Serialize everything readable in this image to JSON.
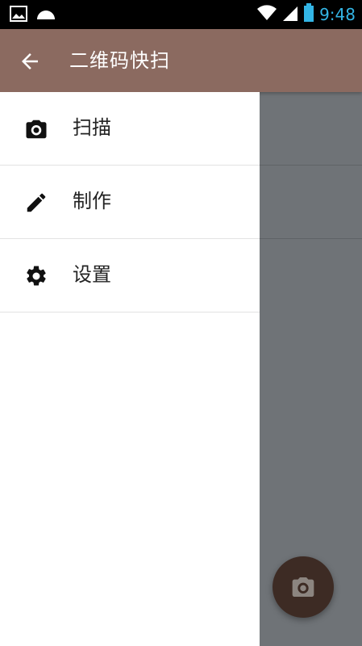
{
  "status_bar": {
    "time": "9:48",
    "icons": [
      "image-icon",
      "cloud-icon",
      "wifi-icon",
      "signal-icon",
      "battery-icon"
    ]
  },
  "app_bar": {
    "title": "二维码快扫",
    "back_icon": "arrow-left-icon"
  },
  "drawer": {
    "items": [
      {
        "label": "扫描",
        "icon": "camera-icon"
      },
      {
        "label": "制作",
        "icon": "pencil-icon"
      },
      {
        "label": "设置",
        "icon": "gear-icon"
      }
    ]
  },
  "fab": {
    "icon": "camera-icon"
  },
  "colors": {
    "app_bar": "#8b6a60",
    "fab": "#3d2b24",
    "scrim": "#6f7377",
    "status_accent": "#33b5e5"
  }
}
